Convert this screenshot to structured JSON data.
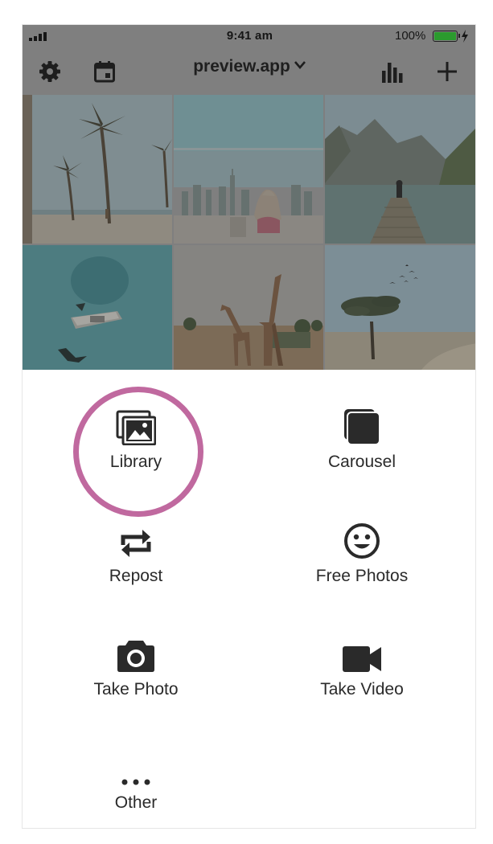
{
  "status_bar": {
    "time": "9:41 am",
    "battery_percent": "100%",
    "signal_icon": "signal-bars-icon",
    "charging_icon": "bolt-icon"
  },
  "toolbar": {
    "account": "preview.app",
    "settings_icon": "gear-icon",
    "calendar_icon": "calendar-icon",
    "stats_icon": "bar-chart-icon",
    "add_icon": "plus-icon"
  },
  "grid": {
    "tiles": [
      {
        "subject": "palm-beach"
      },
      {
        "subject": "city-balcony"
      },
      {
        "subject": "mountain-lake-pier"
      },
      {
        "subject": "ocean-boat-aerial"
      },
      {
        "subject": "giraffes-savanna"
      },
      {
        "subject": "acacia-tree-birds"
      }
    ]
  },
  "actions": [
    {
      "label": "Library",
      "icon": "photo-library-icon",
      "highlighted": true
    },
    {
      "label": "Carousel",
      "icon": "stacked-squares-icon"
    },
    {
      "label": "Repost",
      "icon": "repost-arrows-icon"
    },
    {
      "label": "Free Photos",
      "icon": "smiley-icon"
    },
    {
      "label": "Take Photo",
      "icon": "camera-icon"
    },
    {
      "label": "Take Video",
      "icon": "video-camera-icon"
    },
    {
      "label": "Other",
      "icon": "more-dots-icon"
    }
  ],
  "colors": {
    "highlight_ring": "#c0699f",
    "overlay_dim": "#7f7f7f",
    "battery_fill": "#2b9b2e",
    "icon_dark": "#2a2a2a"
  }
}
